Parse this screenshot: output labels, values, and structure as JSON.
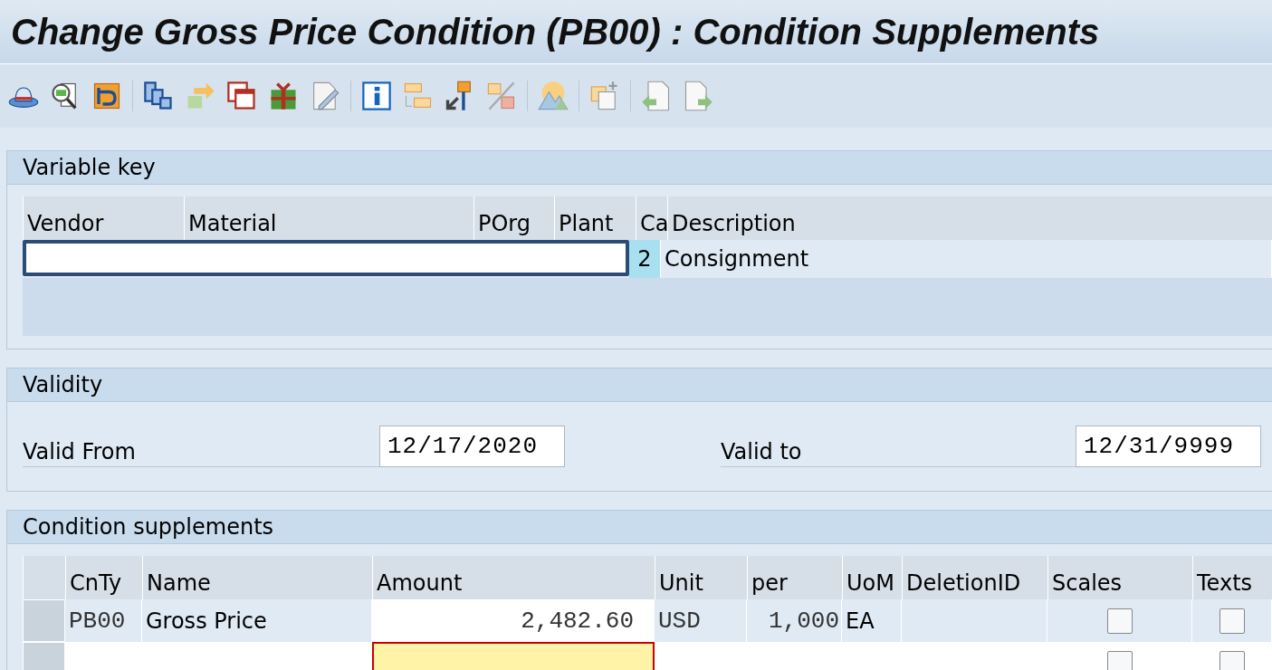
{
  "window": {
    "title": "Change Gross Price Condition (PB00) : Condition Supplements"
  },
  "variable_key": {
    "title": "Variable key",
    "columns": [
      "Vendor",
      "Material",
      "POrg",
      "Plant",
      "Ca",
      "Description"
    ],
    "rows": [
      {
        "category": "2",
        "description": "Consignment"
      }
    ]
  },
  "validity": {
    "title": "Validity",
    "valid_from_label": "Valid From",
    "valid_from": "12/17/2020",
    "valid_to_label": "Valid to",
    "valid_to": "12/31/9999"
  },
  "supplements": {
    "title": "Condition supplements",
    "columns": [
      "CnTy",
      "Name",
      "Amount",
      "Unit",
      "per",
      "UoM",
      "DeletionID",
      "Scales",
      "Texts"
    ],
    "rows": [
      {
        "cnty": "PB00",
        "name": "Gross Price",
        "amount": "2,482.60",
        "unit": "USD",
        "per": "1,000",
        "uom": "EA",
        "scales": false,
        "texts": false
      },
      {
        "scales": false,
        "texts": false
      }
    ]
  }
}
